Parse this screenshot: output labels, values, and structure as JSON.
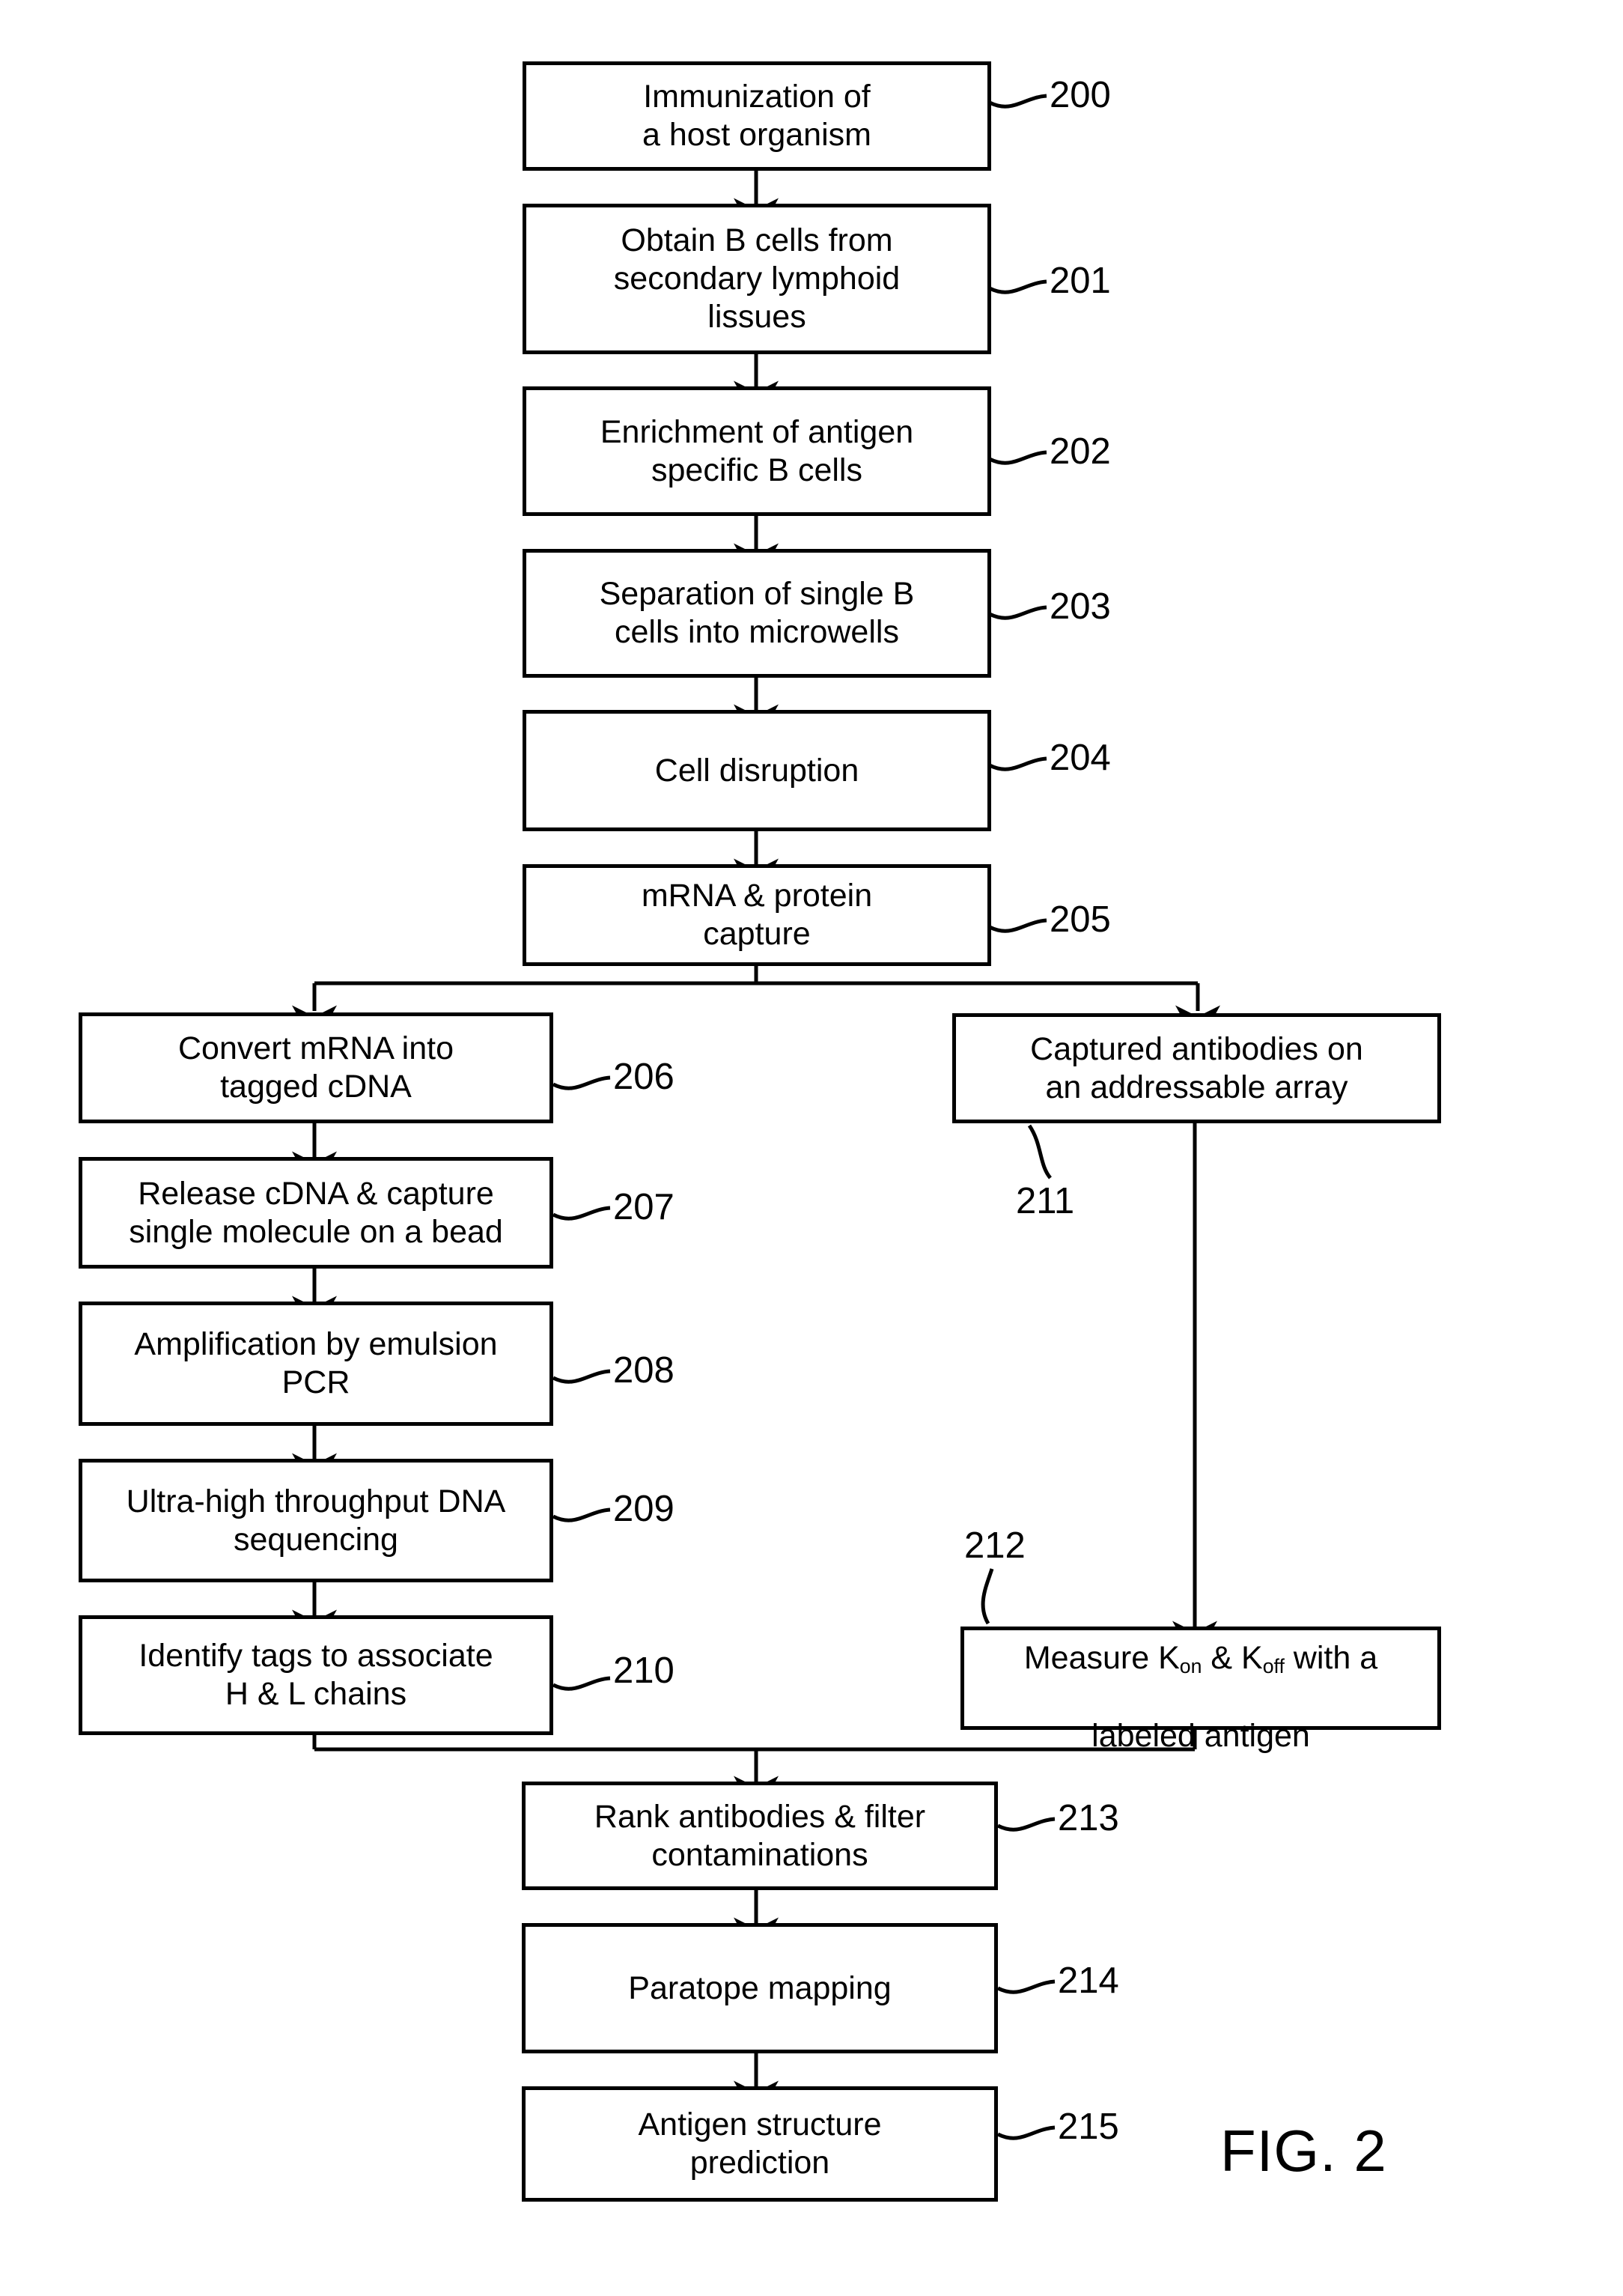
{
  "figure": {
    "caption": "FIG. 2"
  },
  "nodes": [
    {
      "id": "200",
      "ref": "200",
      "text": "Immunization of\na host organism"
    },
    {
      "id": "201",
      "ref": "201",
      "text": "Obtain B cells from\nsecondary lymphoid\nlissues"
    },
    {
      "id": "202",
      "ref": "202",
      "text": "Enrichment of antigen\nspecific B cells"
    },
    {
      "id": "203",
      "ref": "203",
      "text": "Separation of single B\ncells into microwells"
    },
    {
      "id": "204",
      "ref": "204",
      "text": "Cell disruption"
    },
    {
      "id": "205",
      "ref": "205",
      "text": "mRNA & protein\ncapture"
    },
    {
      "id": "206",
      "ref": "206",
      "text": "Convert mRNA into\ntagged cDNA"
    },
    {
      "id": "207",
      "ref": "207",
      "text": "Release cDNA & capture\nsingle molecule on a bead"
    },
    {
      "id": "208",
      "ref": "208",
      "text": "Amplification by emulsion\nPCR"
    },
    {
      "id": "209",
      "ref": "209",
      "text": "Ultra-high throughput DNA\nsequencing"
    },
    {
      "id": "210",
      "ref": "210",
      "text": "Identify tags to associate\nH & L chains"
    },
    {
      "id": "211",
      "ref": "211",
      "text": "Captured antibodies on\nan addressable array"
    },
    {
      "id": "212",
      "ref": "212",
      "text": "",
      "rich": true
    },
    {
      "id": "213",
      "ref": "213",
      "text": "Rank antibodies & filter\ncontaminations"
    },
    {
      "id": "214",
      "ref": "214",
      "text": "Paratope mapping"
    },
    {
      "id": "215",
      "ref": "215",
      "text": "Antigen structure\nprediction"
    }
  ],
  "node_212_text": {
    "part1": "Measure K",
    "sub1": "on",
    "part2": " & K",
    "sub2": "off",
    "part3": " with a",
    "line2": "labeled antigen"
  },
  "refs": {
    "r200": "200",
    "r201": "201",
    "r202": "202",
    "r203": "203",
    "r204": "204",
    "r205": "205",
    "r206": "206",
    "r207": "207",
    "r208": "208",
    "r209": "209",
    "r210": "210",
    "r211": "211",
    "r212": "212",
    "r213": "213",
    "r214": "214",
    "r215": "215"
  },
  "colors": {
    "stroke": "#000000",
    "fill": "#ffffff"
  }
}
